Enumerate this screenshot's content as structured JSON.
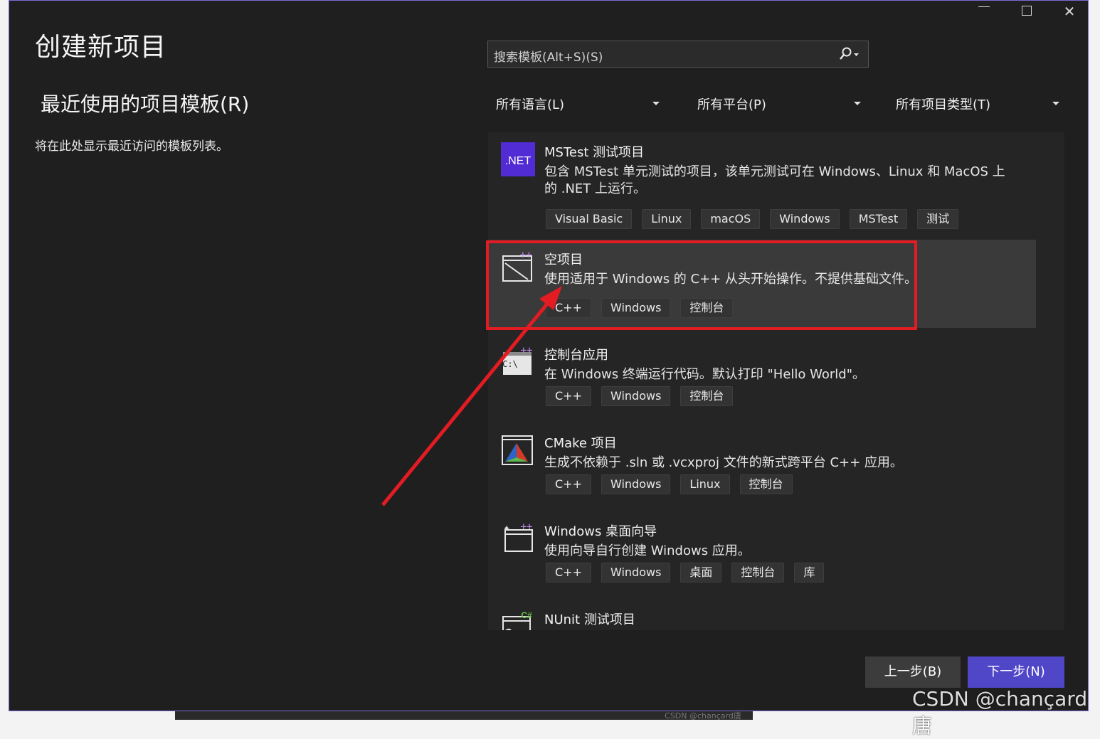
{
  "title": "创建新项目",
  "recent": {
    "heading": "最近使用的项目模板(R)",
    "empty_text": "将在此处显示最近访问的模板列表。"
  },
  "search": {
    "placeholder": "搜索模板(Alt+S)(S)"
  },
  "filters": [
    "所有语言(L)",
    "所有平台(P)",
    "所有项目类型(T)"
  ],
  "templates": [
    {
      "name": "MSTest 测试项目",
      "description": "包含 MSTest 单元测试的项目，该单元测试可在 Windows、Linux 和 MacOS 上的 .NET 上运行。",
      "tags": [
        "Visual Basic",
        "Linux",
        "macOS",
        "Windows",
        "MSTest",
        "测试"
      ],
      "icon": "dotnet-icon",
      "icon_text": ".NET"
    },
    {
      "name": "空项目",
      "description": "使用适用于 Windows 的 C++ 从头开始操作。不提供基础文件。",
      "tags": [
        "C++",
        "Windows",
        "控制台"
      ],
      "icon": "empty-project-icon",
      "selected": true
    },
    {
      "name": "控制台应用",
      "description": "在 Windows 终端运行代码。默认打印 \"Hello World\"。",
      "tags": [
        "C++",
        "Windows",
        "控制台"
      ],
      "icon": "console-app-icon",
      "icon_text": "C:\\"
    },
    {
      "name": "CMake 项目",
      "description": "生成不依赖于 .sln 或 .vcxproj 文件的新式跨平台 C++ 应用。",
      "tags": [
        "C++",
        "Windows",
        "Linux",
        "控制台"
      ],
      "icon": "cmake-icon"
    },
    {
      "name": "Windows 桌面向导",
      "description": "使用向导自行创建 Windows 应用。",
      "tags": [
        "C++",
        "Windows",
        "桌面",
        "控制台",
        "库"
      ],
      "icon": "desktop-wizard-icon"
    },
    {
      "name": "NUnit 测试项目",
      "description": "",
      "tags": [],
      "icon": "nunit-icon",
      "icon_text": "C#"
    }
  ],
  "buttons": {
    "back": "上一步(B)",
    "next": "下一步(N)"
  },
  "watermark": "CSDN @chançard唐",
  "bottom_strip_text": "CSDN @chançard唐",
  "colors": {
    "accent": "#5046c8",
    "highlight": "#e31b23",
    "window_bg": "#1f1f1f",
    "dotnet": "#512bd4"
  }
}
